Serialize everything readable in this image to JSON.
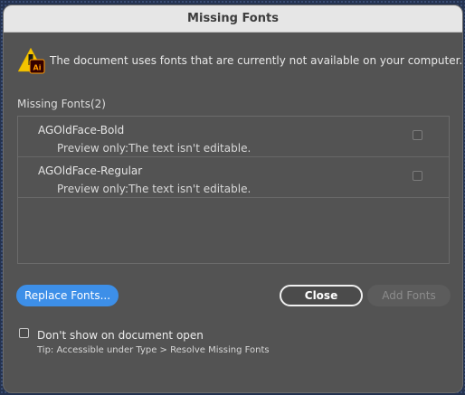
{
  "dialog": {
    "title": "Missing Fonts",
    "message": "The document uses fonts that are currently not available on your computer.",
    "app_badge": "Ai"
  },
  "list": {
    "heading": "Missing Fonts(2)",
    "items": [
      {
        "name": "AGOldFace-Bold",
        "note": "Preview only:The text isn't editable.",
        "checked": false
      },
      {
        "name": "AGOldFace-Regular",
        "note": "Preview only:The text isn't editable.",
        "checked": false
      }
    ]
  },
  "buttons": {
    "replace_label": "Replace Fonts...",
    "close_label": "Close",
    "add_label": "Add Fonts"
  },
  "footer": {
    "dont_show_label": "Don't show on document open",
    "dont_show_checked": false,
    "tip": "Tip: Accessible under Type > Resolve Missing Fonts"
  },
  "icons": {
    "warning": "warning-triangle-icon",
    "app": "illustrator-app-icon",
    "checkbox": "checkbox-icon"
  },
  "colors": {
    "dialog_bg": "#535353",
    "primary_button": "#3d8fe8",
    "warning_yellow": "#f5c400",
    "app_badge": "#330000",
    "app_badge_text": "#ff9a00"
  }
}
